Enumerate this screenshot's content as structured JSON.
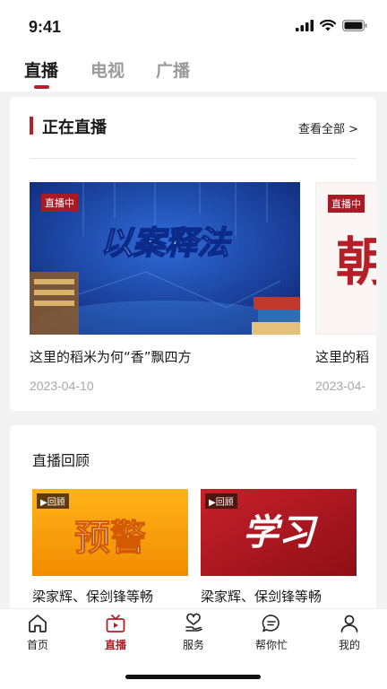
{
  "status_bar": {
    "time": "9:41"
  },
  "top_tabs": [
    {
      "label": "直播",
      "active": true
    },
    {
      "label": "电视",
      "active": false
    },
    {
      "label": "广播",
      "active": false
    }
  ],
  "live_section": {
    "title": "正在直播",
    "view_all": "查看全部 >",
    "items": [
      {
        "badge": "直播中",
        "banner_text": "以案释法",
        "title": "这里的稻米为何“香”飘四方",
        "date": "2023-04-10"
      },
      {
        "badge": "直播中",
        "banner_text": "朝",
        "title": "这里的稻",
        "date": "2023-04-"
      }
    ]
  },
  "replay_section": {
    "title": "直播回顾",
    "items": [
      {
        "badge": "▶回顾",
        "banner_text": "预警",
        "title": "梁家辉、保剑锋等畅"
      },
      {
        "badge": "▶回顾",
        "banner_text": "学习",
        "title": "梁家辉、保剑锋等畅"
      }
    ]
  },
  "bottom_nav": [
    {
      "label": "首页",
      "icon": "home-icon",
      "active": false
    },
    {
      "label": "直播",
      "icon": "tv-icon",
      "active": true
    },
    {
      "label": "服务",
      "icon": "service-icon",
      "active": false
    },
    {
      "label": "帮你忙",
      "icon": "chat-icon",
      "active": false
    },
    {
      "label": "我的",
      "icon": "user-icon",
      "active": false
    }
  ],
  "colors": {
    "accent": "#b51f28",
    "background": "#f3f3f3"
  }
}
